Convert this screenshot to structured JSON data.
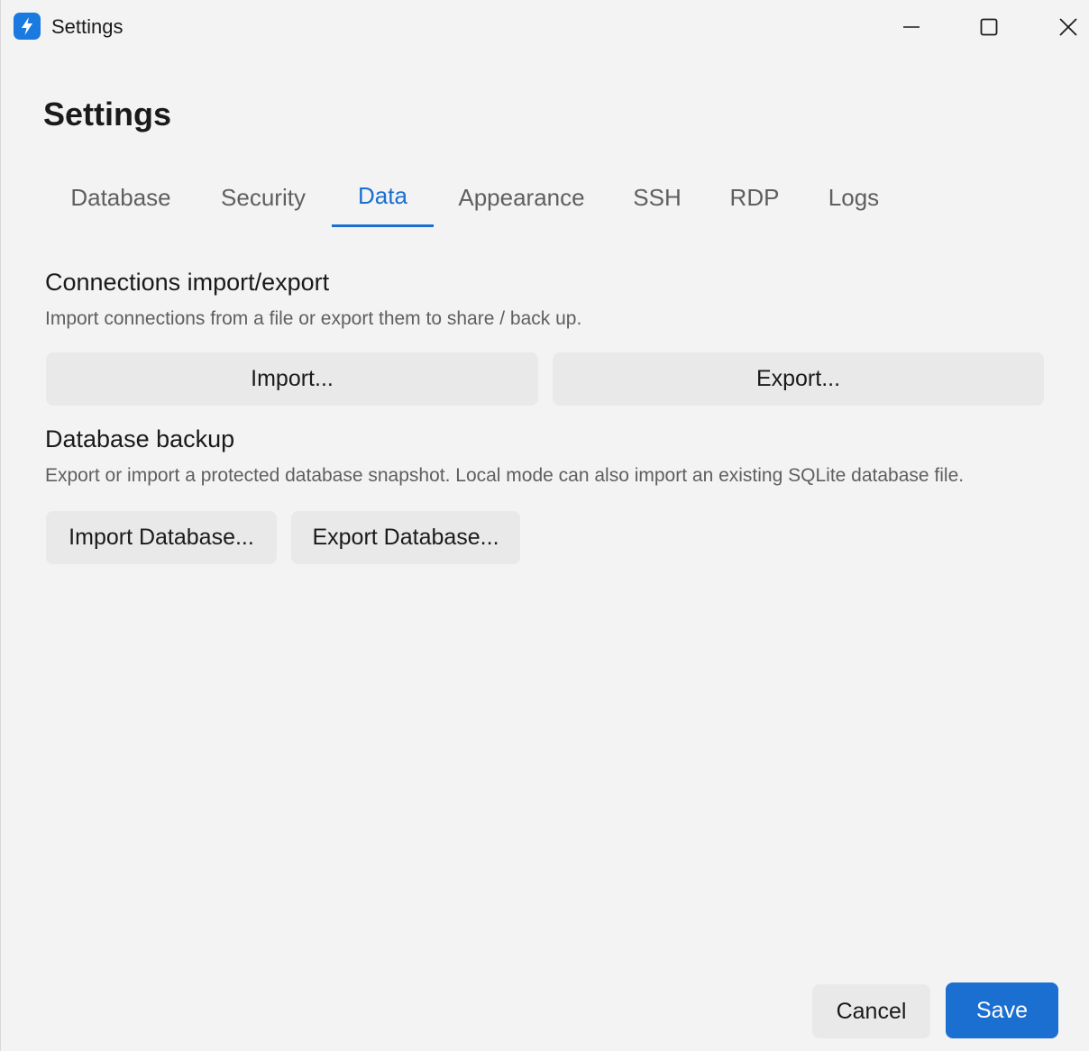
{
  "window": {
    "title": "Settings",
    "icon": "lightning-icon",
    "controls": {
      "minimize_icon": "minimize-icon",
      "maximize_icon": "maximize-icon",
      "close_icon": "close-icon"
    }
  },
  "page": {
    "heading": "Settings"
  },
  "tabs": [
    {
      "label": "Database"
    },
    {
      "label": "Security"
    },
    {
      "label": "Data",
      "active": true
    },
    {
      "label": "Appearance"
    },
    {
      "label": "SSH"
    },
    {
      "label": "RDP"
    },
    {
      "label": "Logs"
    }
  ],
  "sections": {
    "connections": {
      "title": "Connections import/export",
      "description": "Import connections from a file or export them to share / back up.",
      "import_label": "Import...",
      "export_label": "Export..."
    },
    "backup": {
      "title": "Database backup",
      "description": "Export or import a protected database snapshot. Local mode can also import an existing SQLite database file.",
      "import_label": "Import Database...",
      "export_label": "Export Database..."
    }
  },
  "footer": {
    "cancel_label": "Cancel",
    "save_label": "Save"
  },
  "colors": {
    "accent": "#1a6fd1",
    "background": "#f3f3f4",
    "button": "#e9e9ea"
  }
}
